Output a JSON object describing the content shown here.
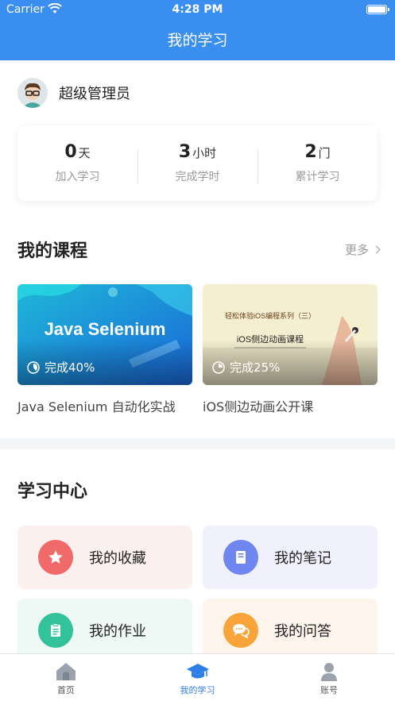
{
  "status_bar": {
    "carrier": "Carrier",
    "time": "4:28 PM"
  },
  "nav": {
    "title": "我的学习"
  },
  "profile": {
    "name": "超级管理员"
  },
  "stats": [
    {
      "value": "0",
      "unit": "天",
      "label": "加入学习"
    },
    {
      "value": "3",
      "unit": "小时",
      "label": "完成学时"
    },
    {
      "value": "2",
      "unit": "门",
      "label": "累计学习"
    }
  ],
  "courses_section": {
    "title": "我的课程",
    "more": "更多"
  },
  "courses": [
    {
      "thumb_text": "Java Selenium",
      "progress_label": "完成40%",
      "progress": 0.4,
      "name": "Java Selenium 自动化实战"
    },
    {
      "thumb_title": "轻松体验iOS编程系列（三）",
      "thumb_text": "iOS侧边动画课程",
      "progress_label": "完成25%",
      "progress": 0.25,
      "name": "iOS侧边动画公开课"
    }
  ],
  "center": {
    "title": "学习中心",
    "items": [
      {
        "label": "我的收藏",
        "icon": "star-icon",
        "color": "#f16a6a"
      },
      {
        "label": "我的笔记",
        "icon": "notebook-icon",
        "color": "#6f86f0"
      },
      {
        "label": "我的作业",
        "icon": "clipboard-icon",
        "color": "#33c39a"
      },
      {
        "label": "我的问答",
        "icon": "chat-bubbles-icon",
        "color": "#f9a43a"
      }
    ]
  },
  "tabbar": [
    {
      "label": "首页",
      "icon": "home-icon"
    },
    {
      "label": "我的学习",
      "icon": "graduation-cap-icon",
      "active": true
    },
    {
      "label": "账号",
      "icon": "user-icon"
    }
  ],
  "colors": {
    "primary": "#3a8ef0",
    "tab_active": "#2f7fe8"
  }
}
